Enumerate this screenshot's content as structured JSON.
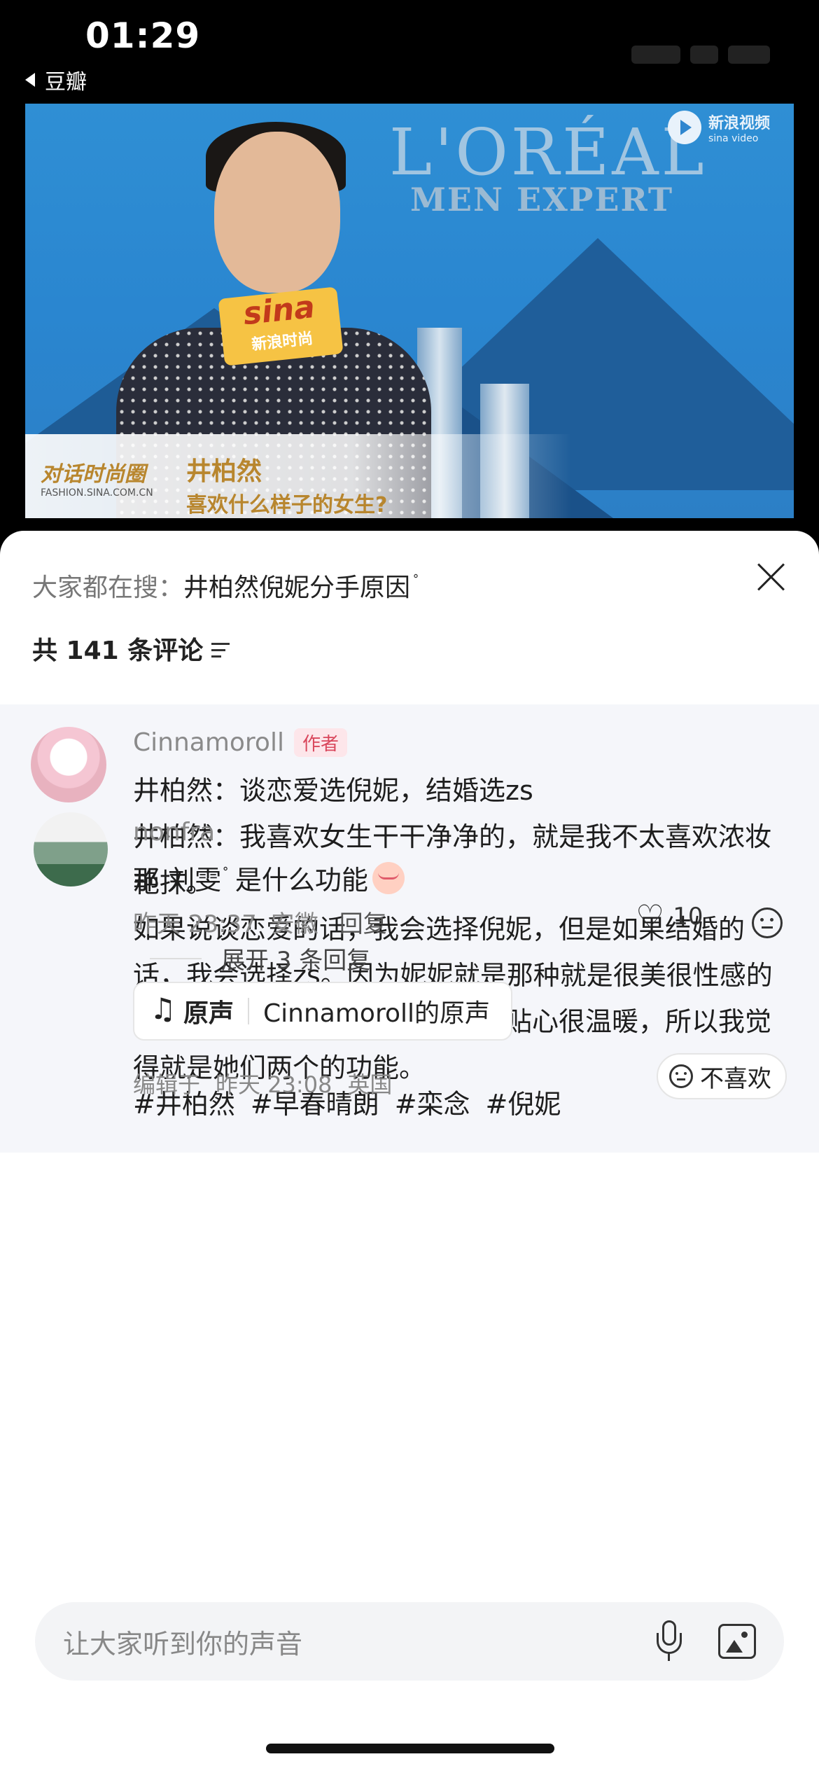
{
  "status_bar": {
    "time": "01:29",
    "back_app": "豆瓣"
  },
  "video": {
    "brand_line1": "L'ORÉAL",
    "brand_line2": "MEN EXPERT",
    "sina_video_cn": "新浪视频",
    "sina_video_en": "sina video",
    "mic_logo": "sina",
    "mic_logo_sub": "新浪时尚",
    "lower_left_title": "对话时尚圈",
    "lower_left_url": "FASHION.SINA.COM.CN",
    "lower_name": "井柏然",
    "lower_question": "喜欢什么样子的女生?"
  },
  "sheet": {
    "search_label": "大家都在搜：",
    "search_term": "井柏然倪妮分手原因",
    "comment_count": "共 141 条评论"
  },
  "main_comment": {
    "username": "Cinnamoroll",
    "author_tag": "作者",
    "lines": [
      "井柏然：谈恋爱选倪妮，结婚选zs",
      "井柏然：我喜欢女生干干净净的，就是我不太喜欢浓妆艳抹。",
      "如果说谈恋爱的话，我会选择倪妮，但是如果结婚的话，我会选择zs。因为妮妮就是那种就是很美很性感的那种，对，但是小爽就是那种很贴心很温暖，所以我觉得就是她们两个的功能。"
    ],
    "hashtags": [
      "#井柏然",
      "#早春晴朗",
      "#栾念",
      "#倪妮"
    ],
    "audio_label": "原声",
    "audio_title": "Cinnamoroll的原声",
    "edited_label": "编辑于",
    "edited_time": "昨天 23:08",
    "location": "英国",
    "dislike_label": "不喜欢"
  },
  "reply_comment": {
    "username": "nonfra",
    "text_prefix": "那 刘雯",
    "text_suffix": "是什么功能",
    "time": "昨天 23:37",
    "location": "安徽",
    "reply_label": "回复",
    "likes": "10",
    "expand_label": "展开 3 条回复"
  },
  "input_bar": {
    "placeholder": "让大家听到你的声音"
  },
  "colors": {
    "author_tag": "#d9475c",
    "sheet_bg": "#ffffff",
    "highlight_bg": "#f5f6fa"
  },
  "icons": [
    "back-triangle-icon",
    "close-icon",
    "sort-icon",
    "music-note-icon",
    "dislike-face-icon",
    "heart-icon",
    "face-icon",
    "microphone-icon",
    "image-icon"
  ]
}
